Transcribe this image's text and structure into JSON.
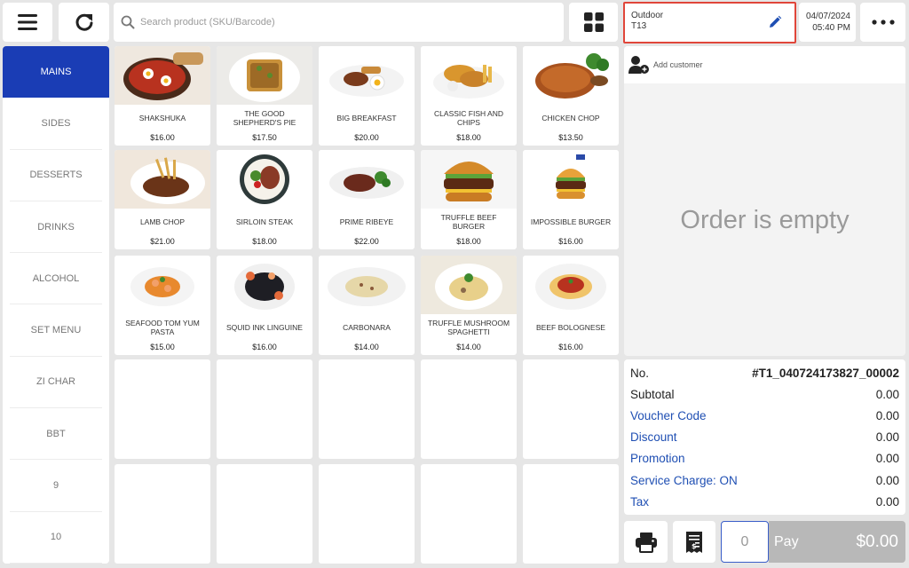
{
  "toolbar": {
    "search_placeholder": "Search product (SKU/Barcode)",
    "table": {
      "zone": "Outdoor",
      "number": "T13"
    },
    "date": "04/07/2024",
    "time": "05:40 PM"
  },
  "categories": [
    {
      "label": "MAINS",
      "active": true
    },
    {
      "label": "SIDES"
    },
    {
      "label": "DESSERTS"
    },
    {
      "label": "DRINKS"
    },
    {
      "label": "ALCOHOL"
    },
    {
      "label": "SET MENU"
    },
    {
      "label": "ZI CHAR"
    },
    {
      "label": "BBT"
    },
    {
      "label": "9"
    },
    {
      "label": "10"
    }
  ],
  "products": [
    {
      "name": "SHAKSHUKA",
      "price": "$16.00"
    },
    {
      "name": "THE GOOD SHEPHERD'S PIE",
      "price": "$17.50"
    },
    {
      "name": "BIG BREAKFAST",
      "price": "$20.00"
    },
    {
      "name": "CLASSIC FISH AND CHIPS",
      "price": "$18.00"
    },
    {
      "name": "CHICKEN CHOP",
      "price": "$13.50"
    },
    {
      "name": "LAMB CHOP",
      "price": "$21.00"
    },
    {
      "name": "SIRLOIN STEAK",
      "price": "$18.00"
    },
    {
      "name": "PRIME RIBEYE",
      "price": "$22.00"
    },
    {
      "name": "TRUFFLE BEEF BURGER",
      "price": "$18.00"
    },
    {
      "name": "IMPOSSIBLE BURGER",
      "price": "$16.00"
    },
    {
      "name": "SEAFOOD TOM YUM PASTA",
      "price": "$15.00"
    },
    {
      "name": "SQUID INK LINGUINE",
      "price": "$16.00"
    },
    {
      "name": "CARBONARA",
      "price": "$14.00"
    },
    {
      "name": "TRUFFLE MUSHROOM SPAGHETTI",
      "price": "$14.00"
    },
    {
      "name": "BEEF BOLOGNESE",
      "price": "$16.00"
    }
  ],
  "order": {
    "add_customer": "Add customer",
    "empty_message": "Order is empty"
  },
  "summary": {
    "no_label": "No.",
    "no_value": "#T1_040724173827_00002",
    "rows": [
      {
        "label": "Subtotal",
        "value": "0.00"
      },
      {
        "label": "Voucher Code",
        "value": "0.00"
      },
      {
        "label": "Discount",
        "value": "0.00"
      },
      {
        "label": "Promotion",
        "value": "0.00"
      },
      {
        "label": "Service Charge: ON",
        "value": "0.00"
      },
      {
        "label": "Tax",
        "value": "0.00"
      }
    ]
  },
  "footer": {
    "quantity": "0",
    "pay_label": "Pay",
    "pay_total": "$0.00"
  },
  "colors": {
    "accent": "#1a3db5",
    "link": "#1f4fb3",
    "highlight_border": "#e0463a",
    "pay_disabled": "#b8b8b8"
  }
}
